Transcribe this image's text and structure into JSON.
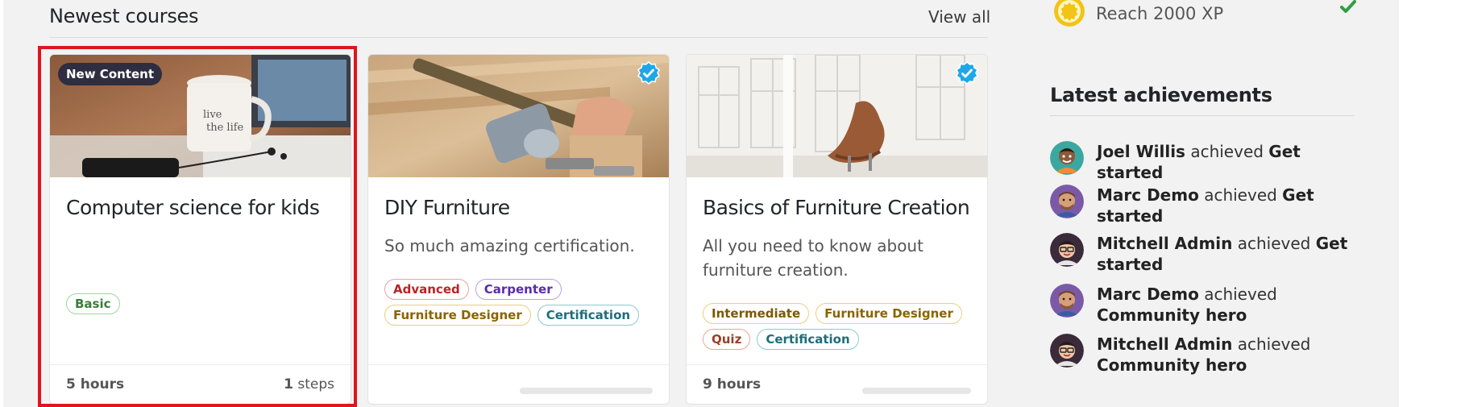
{
  "section": {
    "title": "Newest courses",
    "view_all": "View all"
  },
  "courses": [
    {
      "title": "Computer science for kids",
      "badge": "New Content",
      "description": "",
      "tags": [
        {
          "label": "Basic",
          "style": "basic"
        }
      ],
      "duration": "5 hours",
      "steps_count": "1",
      "steps_label": "steps",
      "thumb_icon": "coffee-mug-laptop-photo"
    },
    {
      "title": "DIY Furniture",
      "description": "So much amazing certification.",
      "tags": [
        {
          "label": "Advanced",
          "style": "advanced"
        },
        {
          "label": "Carpenter",
          "style": "carpenter"
        },
        {
          "label": "Furniture Designer",
          "style": "designer"
        },
        {
          "label": "Certification",
          "style": "cert"
        }
      ],
      "thumb_icon": "hammer-woodwork-photo"
    },
    {
      "title": "Basics of Furniture Creation",
      "description": "All you need to know about furniture creation.",
      "tags": [
        {
          "label": "Intermediate",
          "style": "intermediate"
        },
        {
          "label": "Furniture Designer",
          "style": "designer"
        },
        {
          "label": "Quiz",
          "style": "quiz"
        },
        {
          "label": "Certification",
          "style": "cert"
        }
      ],
      "duration": "9 hours",
      "thumb_icon": "leather-chair-room-photo"
    }
  ],
  "sidebar": {
    "goal": {
      "text": "Reach 2000 XP",
      "icon": "xp-medal-icon",
      "status_icon": "check-icon"
    },
    "achievements_title": "Latest achievements",
    "achieved_word": "achieved",
    "achievements": [
      {
        "user": "Joel Willis",
        "badge": "Get started",
        "avatar": "joel-avatar"
      },
      {
        "user": "Marc Demo",
        "badge": "Get started",
        "avatar": "marc-avatar"
      },
      {
        "user": "Mitchell Admin",
        "badge": "Get started",
        "avatar": "mitchell-avatar"
      },
      {
        "user": "Marc Demo",
        "badge": "Community hero",
        "avatar": "marc-avatar"
      },
      {
        "user": "Mitchell Admin",
        "badge": "Community hero",
        "avatar": "mitchell-avatar"
      }
    ]
  },
  "colors": {
    "highlight": "#e0141e",
    "verified": "#1ea7e8",
    "badge_bg": "#2f2d40"
  }
}
